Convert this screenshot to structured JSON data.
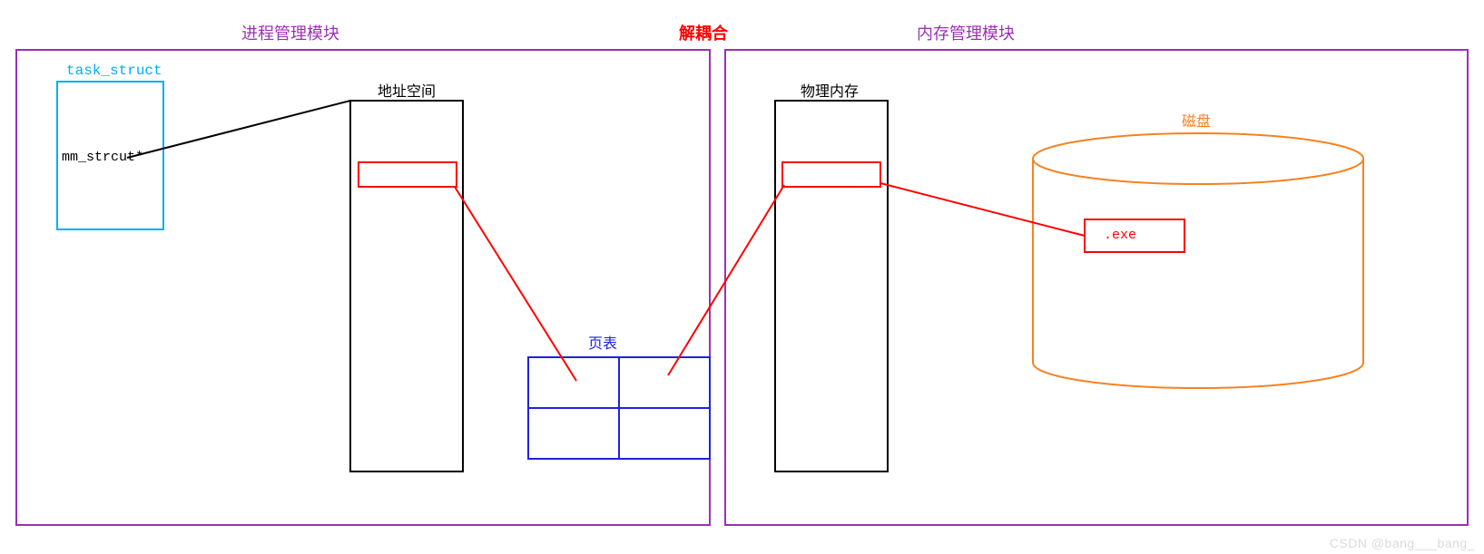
{
  "titles": {
    "process_module": "进程管理模块",
    "decouple": "解耦合",
    "memory_module": "内存管理模块"
  },
  "labels": {
    "task_struct": "task_struct",
    "mm_struct": "mm_strcut*",
    "address_space": "地址空间",
    "page_table": "页表",
    "physical_memory": "物理内存",
    "disk": "磁盘",
    "exe": ".exe"
  },
  "colors": {
    "purple": "#9B30B5",
    "cyan": "#00AEEF",
    "black": "#000000",
    "red": "#FF0000",
    "blue": "#1E22E0",
    "orange": "#F58220"
  },
  "watermark": "CSDN @bang___bang_"
}
